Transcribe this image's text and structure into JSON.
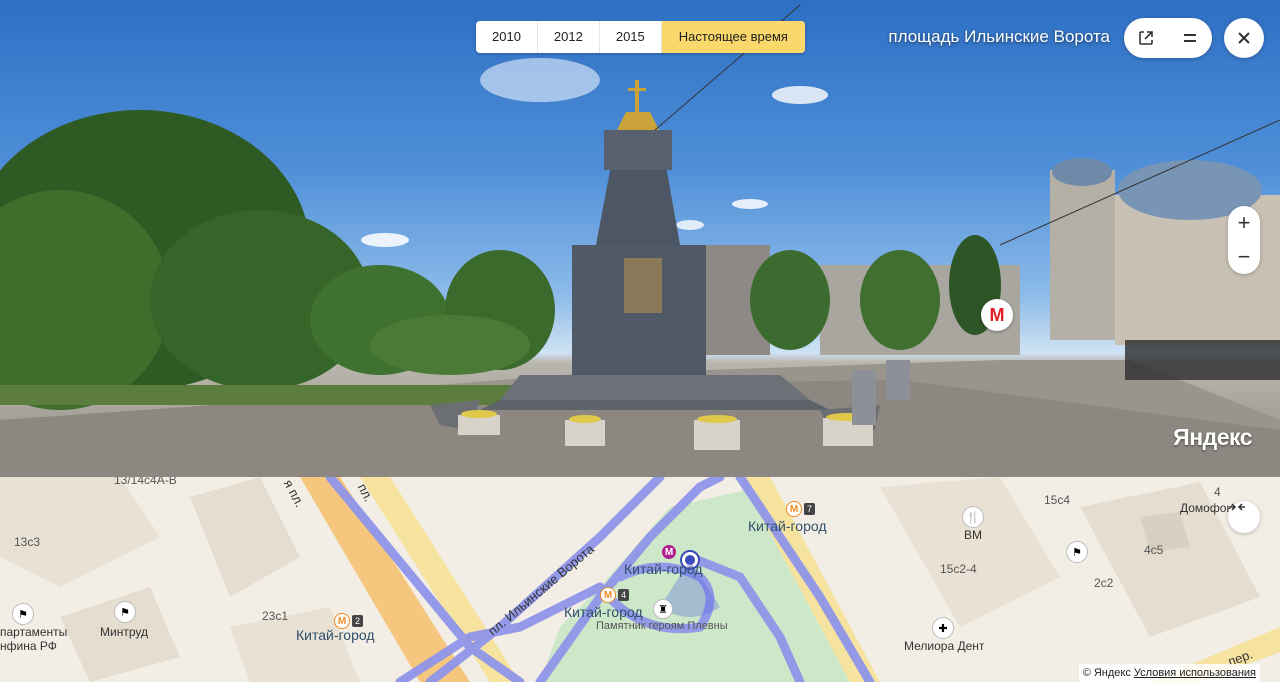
{
  "panorama": {
    "years": [
      "2010",
      "2012",
      "2015"
    ],
    "current_label": "Настоящее время",
    "place_title": "площадь Ильинские Ворота",
    "metro_letter": "М",
    "logo": "Яндекс",
    "zoom_in": "+",
    "zoom_out": "−"
  },
  "map": {
    "labels": {
      "building_1": "13/14с4А-В",
      "building_2": "13с3",
      "building_3": "23с1",
      "building_4": "15с4",
      "building_5": "4",
      "building_6": "4с5",
      "building_7": "2с2",
      "building_8": "15с2-4",
      "apartments": "партаменты",
      "minfin": "нфина РФ",
      "mintrud": "Минтруд",
      "kitay_1": "Китай-город",
      "kitay_2": "Китай-город",
      "kitay_3": "Китай-город",
      "kitay_4": "Китай-город",
      "kitay_5": "Китай-город",
      "street_ilyinskie": "пл. Ильинские Ворота",
      "street_pl1": "я пл.",
      "street_pl2": "пл.",
      "monument": "Памятник героям Плевны",
      "vm": "ВМ",
      "meliora": "Мелиора Дент",
      "domofon": "Домофон",
      "per": "пер.",
      "metro_2": "2",
      "metro_4": "4",
      "metro_7": "7"
    },
    "metro_letter": "М",
    "copyright": "© Яндекс",
    "terms": "Условия использования"
  }
}
